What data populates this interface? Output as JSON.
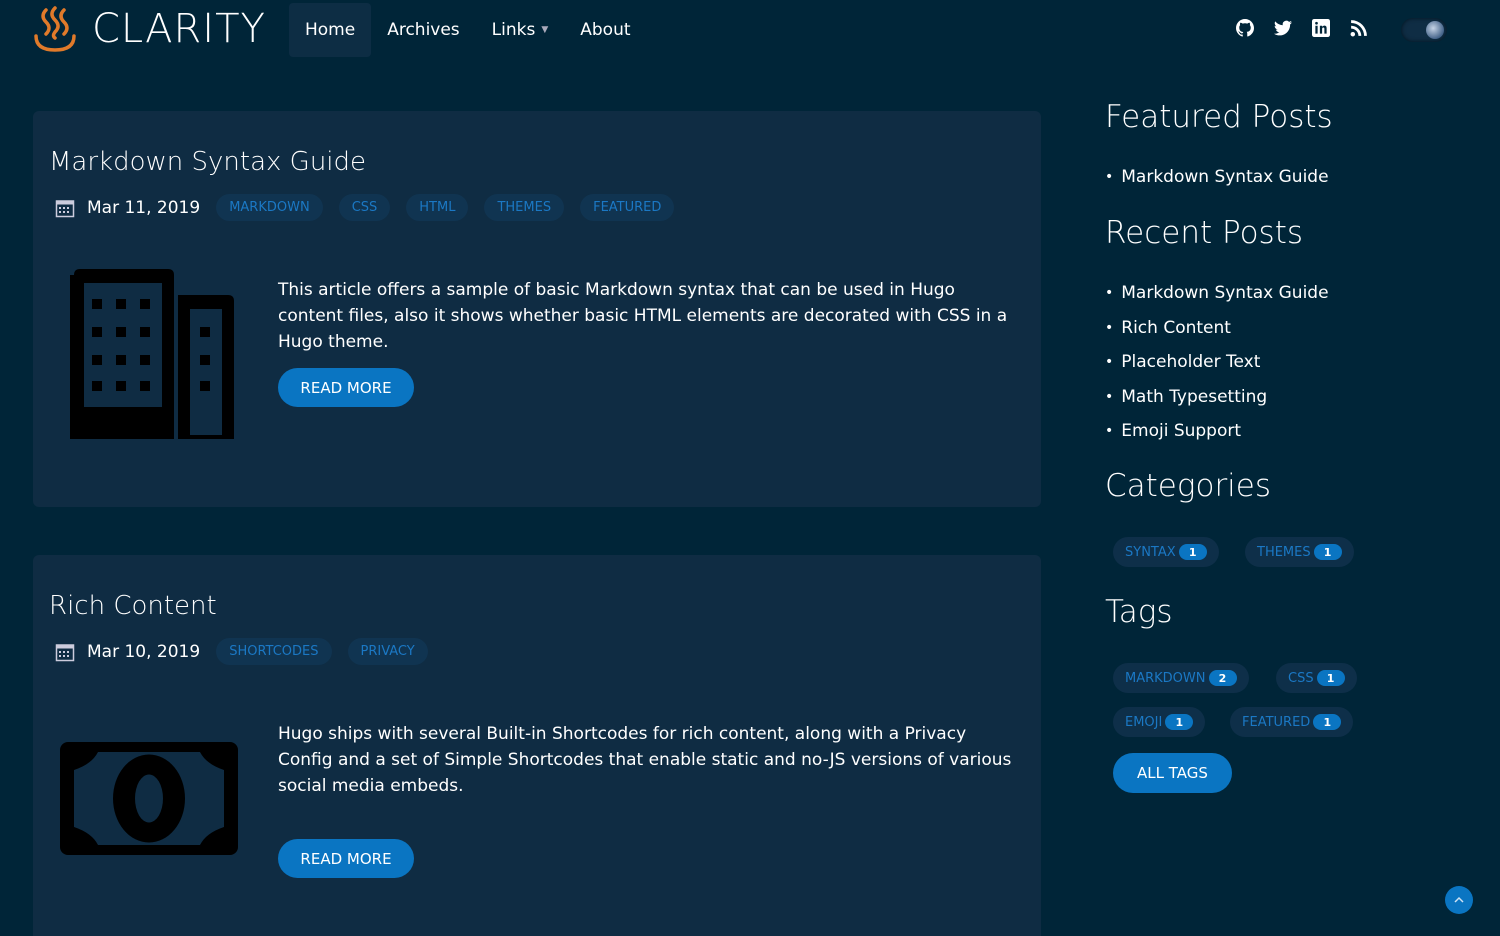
{
  "brand": {
    "name": "CLARITY"
  },
  "nav": {
    "home": "Home",
    "archives": "Archives",
    "links": "Links",
    "about": "About"
  },
  "social_icons": [
    "github-icon",
    "twitter-icon",
    "linkedin-icon",
    "rss-icon"
  ],
  "posts": [
    {
      "title": "Markdown Syntax Guide",
      "date": "Mar 11, 2019",
      "tags": [
        "MARKDOWN",
        "CSS",
        "HTML",
        "THEMES",
        "FEATURED"
      ],
      "excerpt": "This article offers a sample of basic Markdown syntax that can be used in Hugo content files, also it shows whether basic HTML elements are decorated with CSS in a Hugo theme.",
      "read_more": "READ MORE",
      "thumbnail_icon": "building-icon"
    },
    {
      "title": "Rich Content",
      "date": "Mar 10, 2019",
      "tags": [
        "SHORTCODES",
        "PRIVACY"
      ],
      "excerpt": "Hugo ships with several Built-in Shortcodes for rich content, along with a Privacy Config and a set of Simple Shortcodes that enable static and no-JS versions of various social media embeds.",
      "read_more": "READ MORE",
      "thumbnail_icon": "money-bill-icon"
    }
  ],
  "sidebar": {
    "featured_heading": "Featured Posts",
    "featured": [
      "Markdown Syntax Guide"
    ],
    "recent_heading": "Recent Posts",
    "recent": [
      "Markdown Syntax Guide",
      "Rich Content",
      "Placeholder Text",
      "Math Typesetting",
      "Emoji Support"
    ],
    "categories_heading": "Categories",
    "categories": [
      {
        "name": "SYNTAX",
        "count": "1"
      },
      {
        "name": "THEMES",
        "count": "1"
      }
    ],
    "tags_heading": "Tags",
    "tags": [
      {
        "name": "MARKDOWN",
        "count": "2"
      },
      {
        "name": "CSS",
        "count": "1"
      },
      {
        "name": "EMOJI",
        "count": "1"
      },
      {
        "name": "FEATURED",
        "count": "1"
      }
    ],
    "all_tags": "ALL TAGS"
  },
  "colors": {
    "background": "#002538",
    "card": "#0f2c43",
    "accent": "#0a75c2",
    "tag_text": "#1b78c4",
    "logo": "#e07a2a"
  }
}
